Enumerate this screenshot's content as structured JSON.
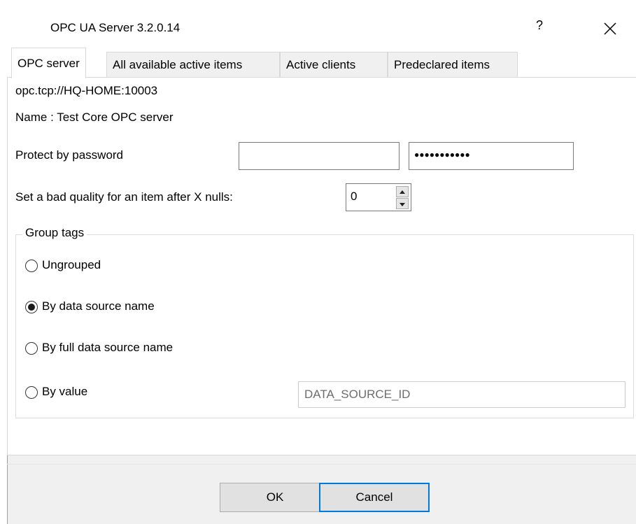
{
  "window": {
    "title": "OPC UA Server 3.2.0.14",
    "help_label": "?",
    "close_icon": "close-icon"
  },
  "tabs": [
    {
      "label": "OPC server",
      "active": true
    },
    {
      "label": "All available active items",
      "active": false
    },
    {
      "label": "Active clients",
      "active": false
    },
    {
      "label": "Predeclared items",
      "active": false
    }
  ],
  "server": {
    "url": "opc.tcp://HQ-HOME:10003",
    "name": "Name : Test Core OPC server"
  },
  "password": {
    "label": "Protect by password",
    "username_value": "",
    "password_mask": "●●●●●●●●●●●"
  },
  "bad_quality": {
    "label": "Set a bad quality for an item after X nulls:",
    "value": "0"
  },
  "group_tags": {
    "legend": "Group tags",
    "options": [
      {
        "label": "Ungrouped",
        "selected": false
      },
      {
        "label": "By data source name",
        "selected": true
      },
      {
        "label": "By full data source name",
        "selected": false
      },
      {
        "label": "By value",
        "selected": false
      }
    ],
    "value_field": "DATA_SOURCE_ID"
  },
  "buttons": {
    "ok": "OK",
    "cancel": "Cancel"
  },
  "colors": {
    "accent": "#0078d7",
    "dialog_bg": "#f0f0f0"
  }
}
